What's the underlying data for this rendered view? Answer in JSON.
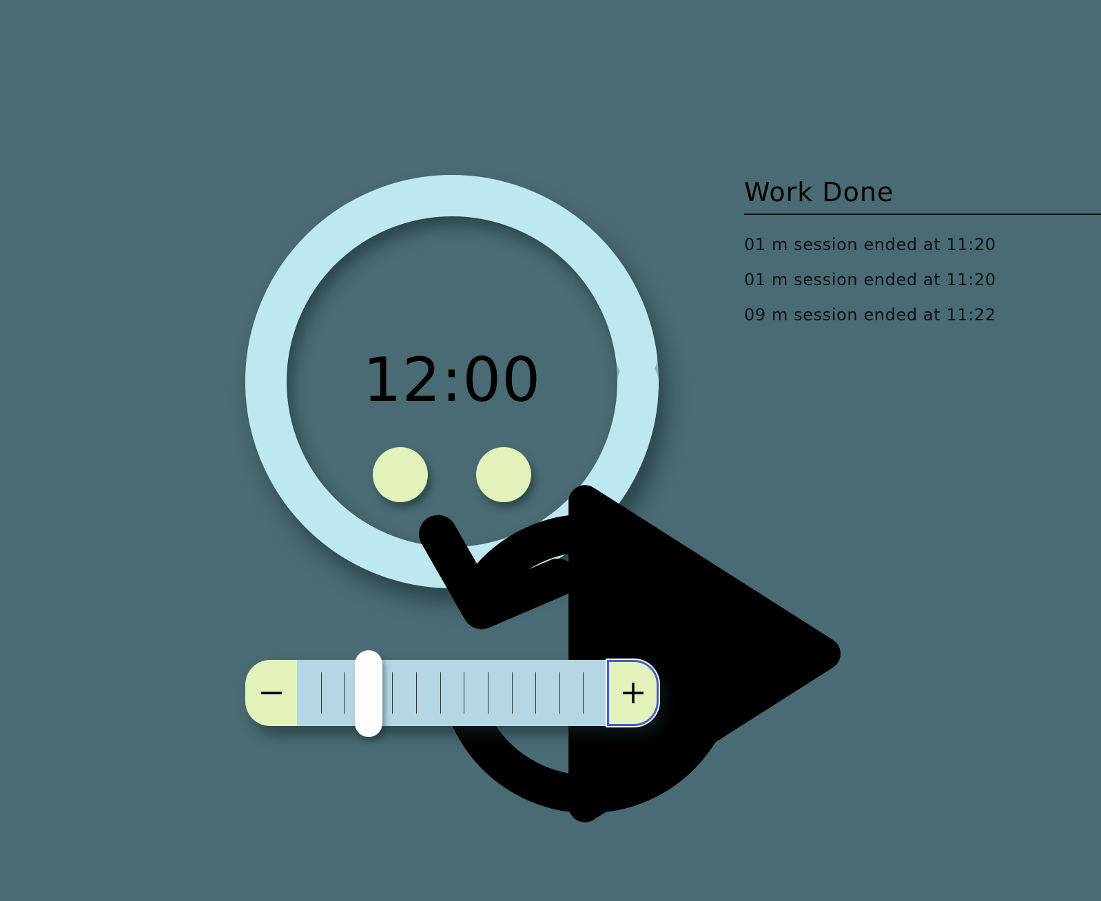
{
  "timer": {
    "time": "12:00",
    "progress_remaining": 0.98,
    "ring_color": "#bde8f0",
    "ring_track_color": "#8fb5b5",
    "reset_label": "reset-icon",
    "play_label": "play-icon"
  },
  "slider": {
    "minus_icon": "minus-icon",
    "plus_icon": "plus-icon",
    "tick_count": 12,
    "value_fraction": 0.23
  },
  "log": {
    "title": "Work Done",
    "entries": [
      "01 m session ended at 11:20",
      "01 m session ended at 11:20",
      "09 m session ended at 11:22"
    ]
  },
  "colors": {
    "background": "#4a6b73",
    "button": "#e3f2bb",
    "slider_track": "#b5d6e3",
    "focus_outline": "#3b62c4"
  }
}
